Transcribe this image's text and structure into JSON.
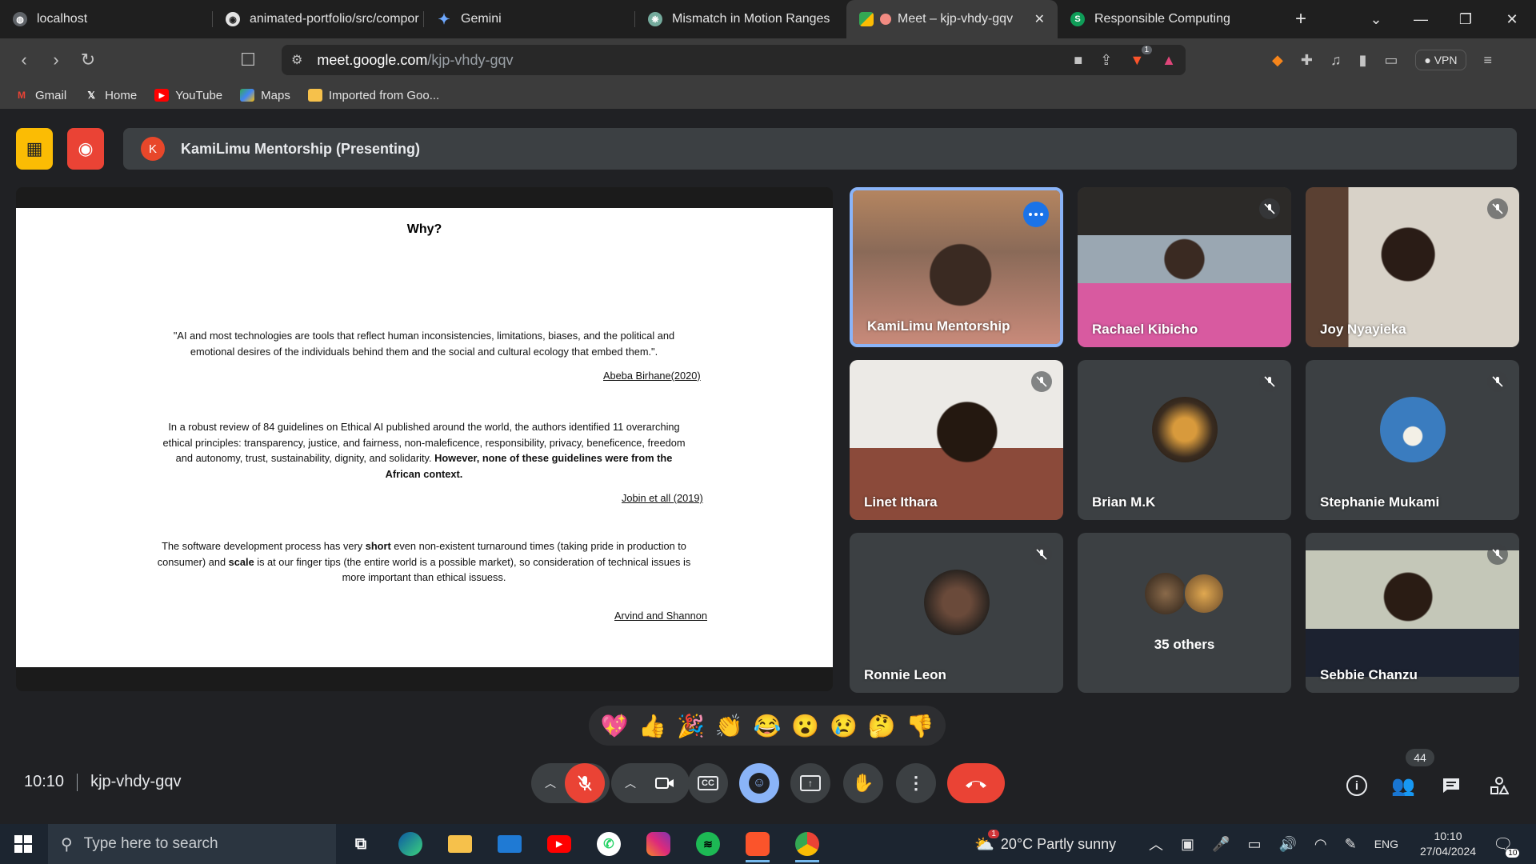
{
  "tabs": [
    {
      "label": "localhost",
      "icon": "globe-icon"
    },
    {
      "label": "animated-portfolio/src/compor",
      "icon": "github-icon"
    },
    {
      "label": "Gemini",
      "icon": "gemini-icon"
    },
    {
      "label": "Mismatch in Motion Ranges",
      "icon": "chatgpt-icon"
    },
    {
      "label": "Meet – kjp-vhdy-gqv",
      "icon": "meet-icon",
      "active": true
    },
    {
      "label": "Responsible Computing",
      "icon": "s-icon"
    }
  ],
  "address": {
    "host": "meet.google.com",
    "path": "/kjp-vhdy-gqv"
  },
  "extensions": {
    "brave_badge": "1",
    "vpn_label": "VPN"
  },
  "bookmarks": [
    {
      "label": "Gmail"
    },
    {
      "label": "Home"
    },
    {
      "label": "YouTube"
    },
    {
      "label": "Maps"
    },
    {
      "label": "Imported from Goo..."
    }
  ],
  "presentation": {
    "presenter_initial": "K",
    "label": "KamiLimu Mentorship (Presenting)"
  },
  "slide": {
    "title": "Why?",
    "quote1_line1": "\"AI and most technologies are tools that reflect human inconsistencies, limitations, biases, and the political and",
    "quote1_line2": "emotional desires of the individuals behind them and the social and cultural ecology that embed them.\".",
    "cite1": "Abeba Birhane(2020)",
    "p2_line1": "In a robust review of 84 guidelines on Ethical AI published around the world, the authors identified 11 overarching",
    "p2_line2": "ethical principles: transparency, justice, and fairness, non-maleficence, responsibility, privacy, beneficence, freedom",
    "p2_line3a": "and autonomy, trust, sustainability, dignity, and solidarity.",
    "p2_line3b": "However, none of these guidelines were from the",
    "p2_line4": "African context.",
    "cite2": "Jobin et all (2019)",
    "p3_line1a": "The software development process has very ",
    "p3_bold1": "short",
    "p3_line1b": " even non-existent turnaround times (taking pride in production to",
    "p3_line2a": "consumer) and ",
    "p3_bold2": "scale",
    "p3_line2b": " is at our finger tips (the entire world is a possible market), so consideration of technical issues is",
    "p3_line3": "more important than ethical issuess.",
    "cite3": "Arvind and Shannon"
  },
  "participants": [
    {
      "name": "KamiLimu Mentorship",
      "state": "speaking"
    },
    {
      "name": "Rachael Kibicho",
      "state": "muted"
    },
    {
      "name": "Joy Nyayieka",
      "state": "muted"
    },
    {
      "name": "Linet Ithara",
      "state": "muted"
    },
    {
      "name": "Brian M.K",
      "state": "muted"
    },
    {
      "name": "Stephanie Mukami",
      "state": "muted"
    },
    {
      "name": "Ronnie Leon",
      "state": "muted"
    },
    {
      "name": "35 others",
      "state": "group"
    },
    {
      "name": "Sebbie Chanzu",
      "state": "muted"
    }
  ],
  "reactions": [
    "💖",
    "👍",
    "🎉",
    "👏",
    "😂",
    "😮",
    "😢",
    "🤔",
    "👎"
  ],
  "meeting": {
    "time": "10:10",
    "code": "kjp-vhdy-gqv",
    "participant_count": "44"
  },
  "taskbar": {
    "search_placeholder": "Type here to search",
    "weather": "20°C  Partly sunny",
    "weather_badge": "1",
    "language": "ENG",
    "time": "10:10",
    "date": "27/04/2024",
    "notifications": "10"
  }
}
